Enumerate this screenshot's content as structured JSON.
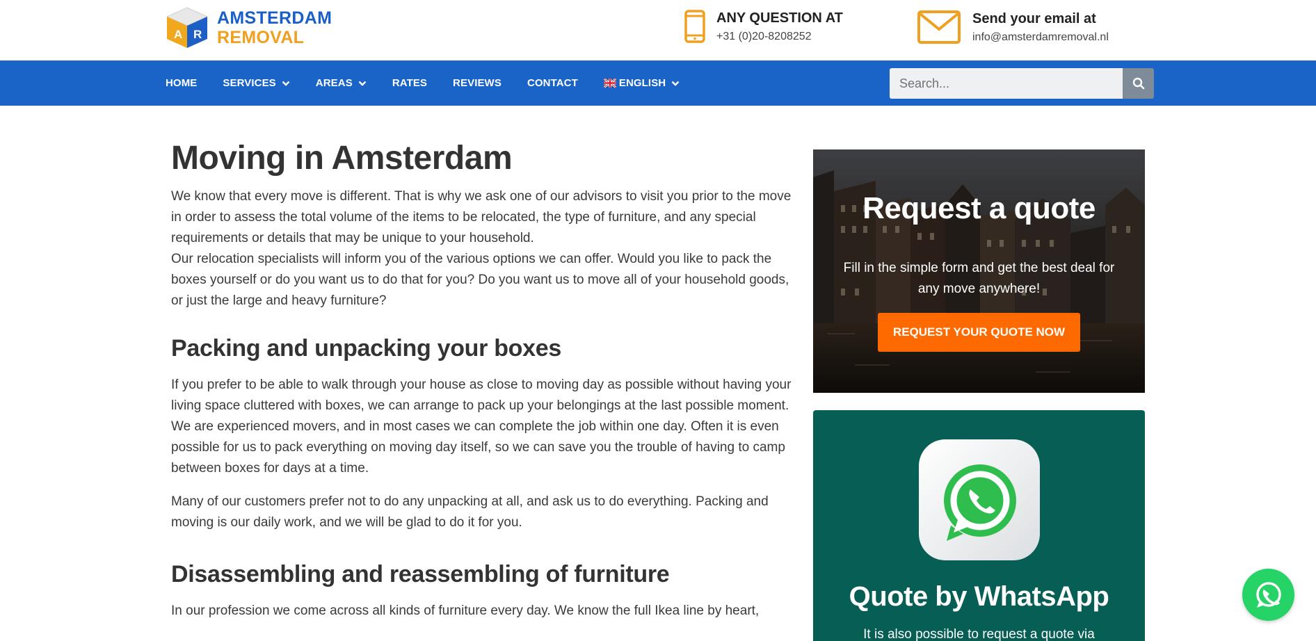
{
  "header": {
    "logo": {
      "line1": "AMSTERDAM",
      "line2": "REMOVAL",
      "cube_letters": [
        "A",
        "R"
      ]
    },
    "phone": {
      "title": "ANY QUESTION AT",
      "value": "+31 (0)20-8208252",
      "icon": "mobile-phone-icon"
    },
    "email": {
      "title": "Send your email at",
      "value": "info@amsterdamremoval.nl",
      "icon": "envelope-icon"
    }
  },
  "nav": {
    "items": [
      {
        "label": "HOME",
        "dropdown": false
      },
      {
        "label": "SERVICES",
        "dropdown": true
      },
      {
        "label": "AREAS",
        "dropdown": true
      },
      {
        "label": "RATES",
        "dropdown": false
      },
      {
        "label": "REVIEWS",
        "dropdown": false
      },
      {
        "label": "CONTACT",
        "dropdown": false
      },
      {
        "label": "ENGLISH",
        "dropdown": true,
        "flag": "uk-flag-icon"
      }
    ],
    "search": {
      "placeholder": "Search...",
      "icon": "search-icon"
    }
  },
  "main": {
    "title": "Moving in Amsterdam",
    "intro": [
      "We know that every move is different. That is why we ask one of our advisors to visit you prior to the move in order to assess the total volume of the items to be relocated, the type of furniture, and any special requirements or details that may be unique to your household.",
      "Our relocation specialists will inform you of the various options we can offer. Would you like to pack the boxes yourself or do you want us to do that for you? Do you want us to move all of your household goods, or just the large and heavy furniture?"
    ],
    "packing_heading": "Packing and unpacking your boxes",
    "packing_paragraphs": [
      "If you prefer to be able to walk through your house as close to moving day as possible without having your living space cluttered with boxes, we can arrange to pack up your belongings at the last possible moment. We are experienced movers, and in most cases we can complete the job within one day. Often it is even possible for us to pack everything on moving day itself, so we can save you the trouble of having to camp between boxes for days at a time.",
      "Many of our customers prefer not to do any unpacking at all, and ask us to do everything. Packing and moving is our daily work, and we will be glad to do it for you."
    ],
    "disassembling_heading": "Disassembling and reassembling of furniture",
    "disassembling_paragraph": "In our profession we come across all kinds of furniture every day. We know the full Ikea line by heart,"
  },
  "sidebar": {
    "quote": {
      "title": "Request a quote",
      "subtitle": "Fill in the simple form and get the best deal for any move anywhere!",
      "button": "REQUEST YOUR QUOTE NOW"
    },
    "whatsapp": {
      "title": "Quote by WhatsApp",
      "subtitle": "It is also possible to request a quote via",
      "icon": "whatsapp-app-icon"
    }
  },
  "floating": {
    "icon": "whatsapp-icon"
  },
  "colors": {
    "brand_blue": "#1a64c8",
    "brand_orange": "#f0a020",
    "cta_orange": "#ff6a00",
    "whatsapp_dark": "#075e54",
    "whatsapp_green": "#25d366"
  }
}
